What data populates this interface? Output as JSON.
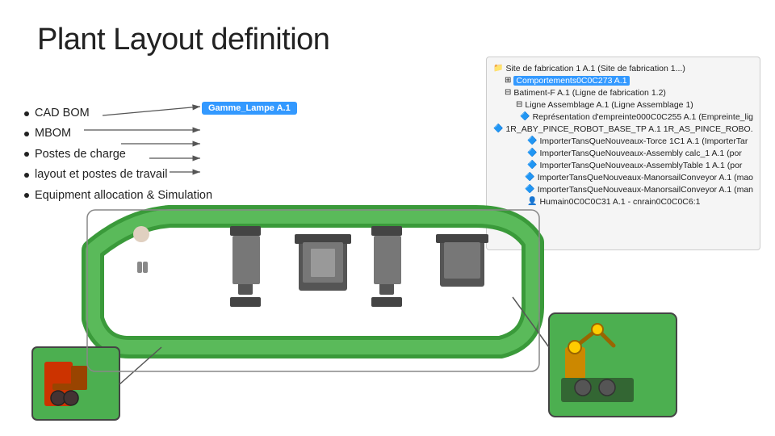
{
  "page": {
    "title": "Plant Layout definition"
  },
  "bullets": [
    {
      "id": "cad-bom",
      "text": "CAD BOM"
    },
    {
      "id": "mbom",
      "text": "MBOM"
    },
    {
      "id": "postes-charge",
      "text": "Postes de charge"
    },
    {
      "id": "layout",
      "text": "layout et postes de travail"
    },
    {
      "id": "equipment",
      "text": "Equipment allocation & Simulation"
    }
  ],
  "gamme_label": "Gamme_Lampe A.1",
  "tree": {
    "rows": [
      {
        "indent": 0,
        "icon": "📁",
        "label": "Site de fabrication 1 A.1 (Site de fabrication 1...)",
        "highlight": false
      },
      {
        "indent": 1,
        "icon": "➕",
        "label": "Comportements0C0C273 A.1",
        "highlight": true
      },
      {
        "indent": 1,
        "icon": "➖",
        "label": "Batiment-F A.1 (Ligne de fabrication 1.2)",
        "highlight": false
      },
      {
        "indent": 2,
        "icon": "➖",
        "label": "Ligne Assemblage A.1 (Ligne Assemblage 1)",
        "highlight": false
      },
      {
        "indent": 3,
        "icon": "🔧",
        "label": "Représentation d'empreinte000C0C255 A.1 (Empreinte_lig",
        "highlight": false
      },
      {
        "indent": 3,
        "icon": "🔧",
        "label": "1R_ABY_PINCE_ROBOT_BASE_TP A.1 1R_AS_PINCE_ROBO...",
        "highlight": false
      },
      {
        "indent": 3,
        "icon": "🔧",
        "label": "ImporterTansQueNouveaux-Torce 1C1 A.1 (ImporterTar",
        "highlight": false
      },
      {
        "indent": 3,
        "icon": "🔧",
        "label": "ImporterTansQueNouveaux-Assembly calc_1 A.1 (por",
        "highlight": false
      },
      {
        "indent": 3,
        "icon": "🔧",
        "label": "ImporterTansQueNouveaux-AssemblyTable 1 A.1 (por",
        "highlight": false
      },
      {
        "indent": 3,
        "icon": "🔧",
        "label": "ImporterTansQueNouveaux-ManorsailConveyor A.1 (mao",
        "highlight": false
      },
      {
        "indent": 3,
        "icon": "🔧",
        "label": "ImporterTansQueNouveaux-ManorsailConveyor A.1 (man",
        "highlight": false
      },
      {
        "indent": 3,
        "icon": "👤",
        "label": "Humain0C0C0C31 A.1 - cnrain0C0C0C6:1",
        "highlight": false
      }
    ]
  }
}
